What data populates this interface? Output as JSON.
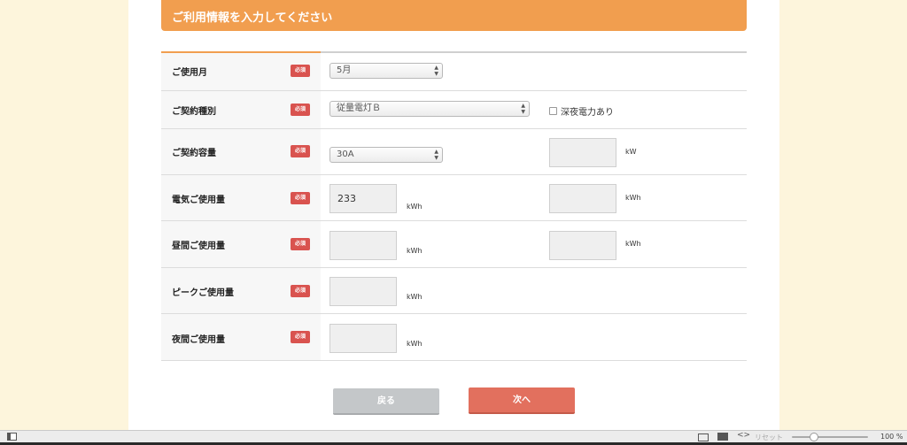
{
  "header": {
    "title": "ご利用情報を入力してください"
  },
  "required_badge": "必須",
  "rows": {
    "month": {
      "label": "ご使用月",
      "select_value": "5月"
    },
    "contract_type": {
      "label": "ご契約種別",
      "select_value": "従量電灯Ｂ",
      "checkbox_label": "深夜電力あり"
    },
    "capacity": {
      "label": "ご契約容量",
      "select_value": "30A",
      "unit_right": "kW"
    },
    "electric": {
      "label": "電気ご使用量",
      "value": "233",
      "unit": "kWh",
      "unit_right": "kWh"
    },
    "daytime": {
      "label": "昼間ご使用量",
      "unit": "kWh",
      "unit_right": "kWh"
    },
    "peak": {
      "label": "ピークご使用量",
      "unit": "kWh"
    },
    "night": {
      "label": "夜間ご使用量",
      "unit": "kWh"
    }
  },
  "buttons": {
    "back": "戻る",
    "next": "次へ"
  },
  "statusbar": {
    "reset": "リセット",
    "zoom": "100 %"
  },
  "icons": {
    "sidebar": "sidebar-toggle-icon",
    "screen": "screen-icon",
    "image": "image-icon",
    "code": "code-icon"
  },
  "colors": {
    "header_orange": "#f19e4f",
    "required_red": "#d9534f",
    "next_button": "#e2705e",
    "back_button": "#c4c7c9",
    "background": "#fdf5dc"
  }
}
